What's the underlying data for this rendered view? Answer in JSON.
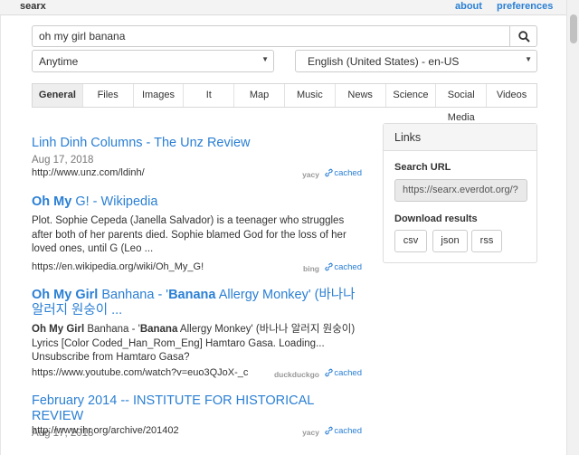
{
  "header": {
    "brand": "searx",
    "about": "about",
    "preferences": "preferences"
  },
  "search": {
    "query": "oh my girl banana",
    "button_icon": "search-icon"
  },
  "filters": {
    "time_range": "Anytime",
    "language": "English (United States) - en-US"
  },
  "categories": [
    "General",
    "Files",
    "Images",
    "It",
    "Map",
    "Music",
    "News",
    "Science",
    "Social Media",
    "Videos"
  ],
  "active_category": "General",
  "results": [
    {
      "title": "Linh Dinh Columns - The Unz Review",
      "date": "Aug 17, 2018",
      "url": "http://www.unz.com/ldinh/",
      "engine": "yacy",
      "cached": "cached"
    },
    {
      "title_bold": "Oh My",
      "title_rest": " G! - Wikipedia",
      "content": "Plot. Sophie Cepeda (Janella Salvador) is a teenager who struggles after both of her parents died. Sophie blamed God for the loss of her loved ones, until G (Leo ...",
      "url": "https://en.wikipedia.org/wiki/Oh_My_G!",
      "engine": "bing",
      "cached": "cached"
    },
    {
      "title_b1": "Oh My Girl",
      "title_p1": " Banhana - '",
      "title_b2": "Banana",
      "title_p2": " Allergy Monkey' (바나나 알러지 원숭이 ...",
      "content_b1": "Oh My Girl",
      "content_p1": " Banhana - '",
      "content_b2": "Banana",
      "content_p2": " Allergy Monkey' (바나나 알러지 원숭이) Lyrics [Color Coded_Han_Rom_Eng] Hamtaro Gasa. Loading... Unsubscribe from Hamtaro Gasa?",
      "url": "https://www.youtube.com/watch?v=euo3QJoX-_c",
      "engine": "duckduckgo",
      "cached": "cached"
    },
    {
      "title": "February 2014 -- INSTITUTE FOR HISTORICAL REVIEW",
      "date": "Aug 17, 2018",
      "url": "http://www.ihr.org/archive/201402",
      "engine": "yacy",
      "cached": "cached"
    }
  ],
  "links_panel": {
    "title": "Links",
    "search_url_label": "Search URL",
    "search_url": "https://searx.everdot.org/?",
    "download_label": "Download results",
    "formats": [
      "csv",
      "json",
      "rss"
    ]
  },
  "colors": {
    "link": "#2a7fd4",
    "muted": "#999999",
    "topbar": "#f3f3f3"
  }
}
